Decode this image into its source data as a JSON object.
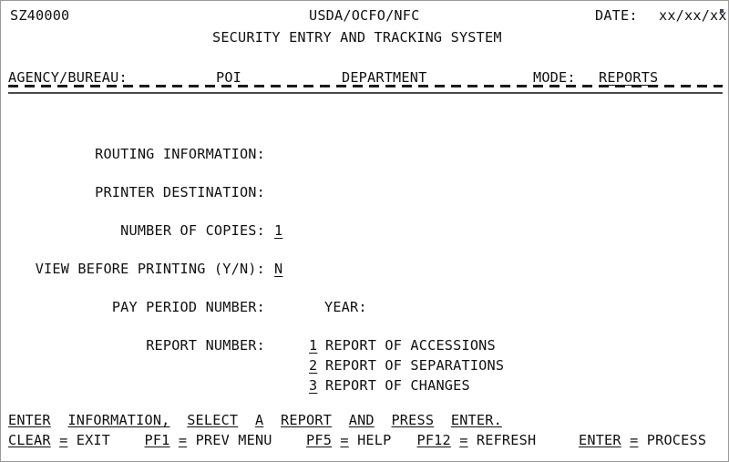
{
  "header": {
    "screen_id": "SZ40000",
    "system_owner": "USDA/OCFO/NFC",
    "system_title": "SECURITY ENTRY AND TRACKING SYSTEM",
    "date_label": "DATE:",
    "date_value": "xx/xx/xx"
  },
  "field_bar": {
    "agency_label": "AGENCY/BUREAU:",
    "poi_label": "POI",
    "department_label": "DEPARTMENT",
    "mode_label": "MODE:",
    "mode_value": "REPORTS"
  },
  "form": {
    "routing_label": "ROUTING INFORMATION:",
    "routing_value": "",
    "printer_label": "PRINTER DESTINATION:",
    "printer_value": "",
    "copies_label": "NUMBER OF COPIES:",
    "copies_value": "1",
    "view_label": "VIEW BEFORE PRINTING (Y/N):",
    "view_value": "N",
    "pay_period_label": "PAY PERIOD NUMBER:",
    "pay_period_value": "",
    "year_label": "YEAR:",
    "year_value": "",
    "report_label": "REPORT NUMBER:",
    "report_options": [
      {
        "number": "1",
        "text": "REPORT OF ACCESSIONS"
      },
      {
        "number": "2",
        "text": "REPORT OF SEPARATIONS"
      },
      {
        "number": "3",
        "text": "REPORT OF CHANGES"
      }
    ]
  },
  "footer": {
    "instruction_words": [
      "ENTER",
      "INFORMATION,",
      "SELECT",
      "A",
      "REPORT",
      "AND",
      "PRESS",
      "ENTER."
    ],
    "keys": [
      {
        "key": "CLEAR",
        "eq": "=",
        "action": "EXIT"
      },
      {
        "key": "PF1",
        "eq": "=",
        "action": "PREV MENU"
      },
      {
        "key": "PF5",
        "eq": "=",
        "action": "HELP"
      },
      {
        "key": "PF12",
        "eq": "=",
        "action": "REFRESH"
      },
      {
        "key": "ENTER",
        "eq": "=",
        "action": "PROCESS"
      }
    ]
  }
}
